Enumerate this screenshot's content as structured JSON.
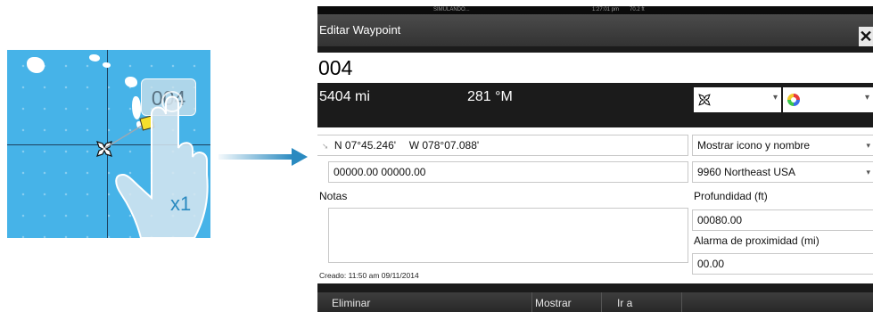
{
  "illustration": {
    "bubble_label": "004",
    "tap_count": "x1",
    "colors": {
      "sea": "#46b3e8",
      "land": "#ffffff",
      "waypoint": "#f5e02c",
      "arrow": "#2a8ac0"
    }
  },
  "status_bar": {
    "mode": "SIMULANDO...",
    "time": "1:27:01 pm",
    "depth": "70.2 ft"
  },
  "dialog": {
    "title": "Editar Waypoint",
    "close_icon": "close-icon",
    "name": "004",
    "distance": "5404 mi",
    "bearing": "281 °M",
    "symbol_icon": "waypoint-cross-icon",
    "color_icon": "color-wheel-icon"
  },
  "form": {
    "position_lat": "N 07°45.246'",
    "position_lon": "W 078°07.088'",
    "loran": "00000.00  00000.00",
    "display_mode": "Mostrar icono y nombre",
    "loran_chain": "9960 Northeast USA",
    "notes_label": "Notas",
    "depth_label": "Profundidad (ft)",
    "depth_value": "00080.00",
    "proximity_label": "Alarma de proximidad (mi)",
    "proximity_value": "00.00",
    "created": "Creado: 11:50 am  09/11/2014"
  },
  "buttons": {
    "delete": "Eliminar",
    "show": "Mostrar",
    "goto": "Ir a"
  },
  "theme": {
    "dialog_bg": "#1b1b1b",
    "titlebar": "#3f3f3f",
    "panel": "#ffffff"
  }
}
